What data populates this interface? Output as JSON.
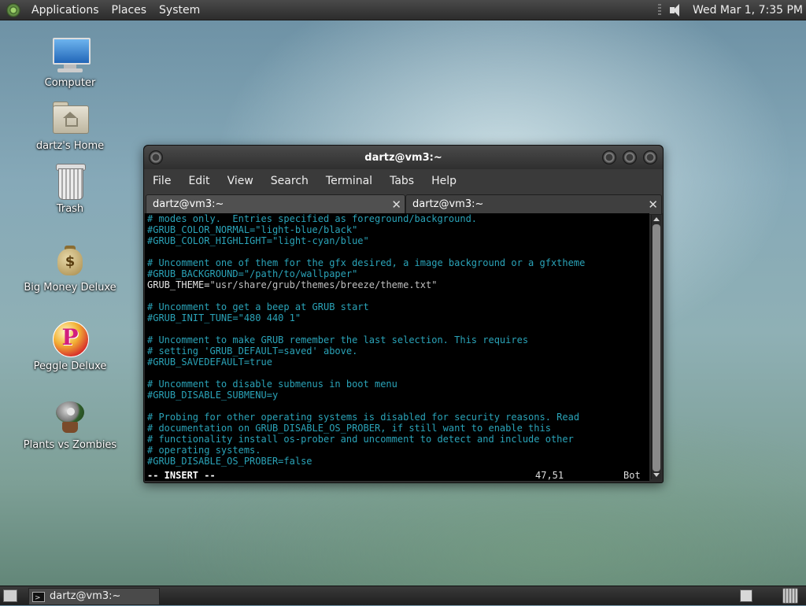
{
  "top_panel": {
    "menus": [
      "Applications",
      "Places",
      "System"
    ],
    "datetime": "Wed Mar 1, 7:35 PM",
    "icons": [
      "distro-logo-icon",
      "volume-icon"
    ]
  },
  "desktop": {
    "icons": [
      {
        "label": "Computer",
        "icon": "computer-icon"
      },
      {
        "label": "dartz's Home",
        "icon": "home-folder-icon"
      },
      {
        "label": "Trash",
        "icon": "trash-icon"
      },
      {
        "label": "Big Money Deluxe",
        "icon": "money-bag-icon"
      },
      {
        "label": "Peggle Deluxe",
        "icon": "peggle-icon"
      },
      {
        "label": "Plants vs Zombies",
        "icon": "plants-icon"
      }
    ]
  },
  "window": {
    "title": "dartz@vm3:~",
    "menubar": [
      "File",
      "Edit",
      "View",
      "Search",
      "Terminal",
      "Tabs",
      "Help"
    ],
    "tabs": [
      {
        "label": "dartz@vm3:~",
        "active": true
      },
      {
        "label": "dartz@vm3:~",
        "active": false
      }
    ],
    "terminal_lines": [
      {
        "text": "# modes only.  Entries specified as foreground/background.",
        "kind": "cmt"
      },
      {
        "text": "#GRUB_COLOR_NORMAL=\"light-blue/black\"",
        "kind": "cmt"
      },
      {
        "text": "#GRUB_COLOR_HIGHLIGHT=\"light-cyan/blue\"",
        "kind": "cmt"
      },
      {
        "text": "",
        "kind": "pln"
      },
      {
        "text": "# Uncomment one of them for the gfx desired, a image background or a gfxtheme",
        "kind": "cmt"
      },
      {
        "text": "#GRUB_BACKGROUND=\"/path/to/wallpaper\"",
        "kind": "cmt"
      },
      {
        "text": "GRUB_THEME=",
        "kind": "pln",
        "rest": "\"usr/share/grub/themes/breeze/theme.txt\""
      },
      {
        "text": "",
        "kind": "pln"
      },
      {
        "text": "# Uncomment to get a beep at GRUB start",
        "kind": "cmt"
      },
      {
        "text": "#GRUB_INIT_TUNE=\"480 440 1\"",
        "kind": "cmt"
      },
      {
        "text": "",
        "kind": "pln"
      },
      {
        "text": "# Uncomment to make GRUB remember the last selection. This requires",
        "kind": "cmt"
      },
      {
        "text": "# setting 'GRUB_DEFAULT=saved' above.",
        "kind": "cmt"
      },
      {
        "text": "#GRUB_SAVEDEFAULT=true",
        "kind": "cmt"
      },
      {
        "text": "",
        "kind": "pln"
      },
      {
        "text": "# Uncomment to disable submenus in boot menu",
        "kind": "cmt"
      },
      {
        "text": "#GRUB_DISABLE_SUBMENU=y",
        "kind": "cmt"
      },
      {
        "text": "",
        "kind": "pln"
      },
      {
        "text": "# Probing for other operating systems is disabled for security reasons. Read",
        "kind": "cmt"
      },
      {
        "text": "# documentation on GRUB_DISABLE_OS_PROBER, if still want to enable this",
        "kind": "cmt"
      },
      {
        "text": "# functionality install os-prober and uncomment to detect and include other",
        "kind": "cmt"
      },
      {
        "text": "# operating systems.",
        "kind": "cmt"
      },
      {
        "text": "#GRUB_DISABLE_OS_PROBER=false",
        "kind": "cmt"
      }
    ],
    "status": {
      "mode": "-- INSERT --",
      "position": "47,51",
      "scroll": "Bot"
    }
  },
  "bottom_panel": {
    "task_label": "dartz@vm3:~"
  },
  "colors": {
    "comment": "#2aa3b8",
    "string": "#c0c0c0",
    "panel": "#2c2c2c"
  }
}
